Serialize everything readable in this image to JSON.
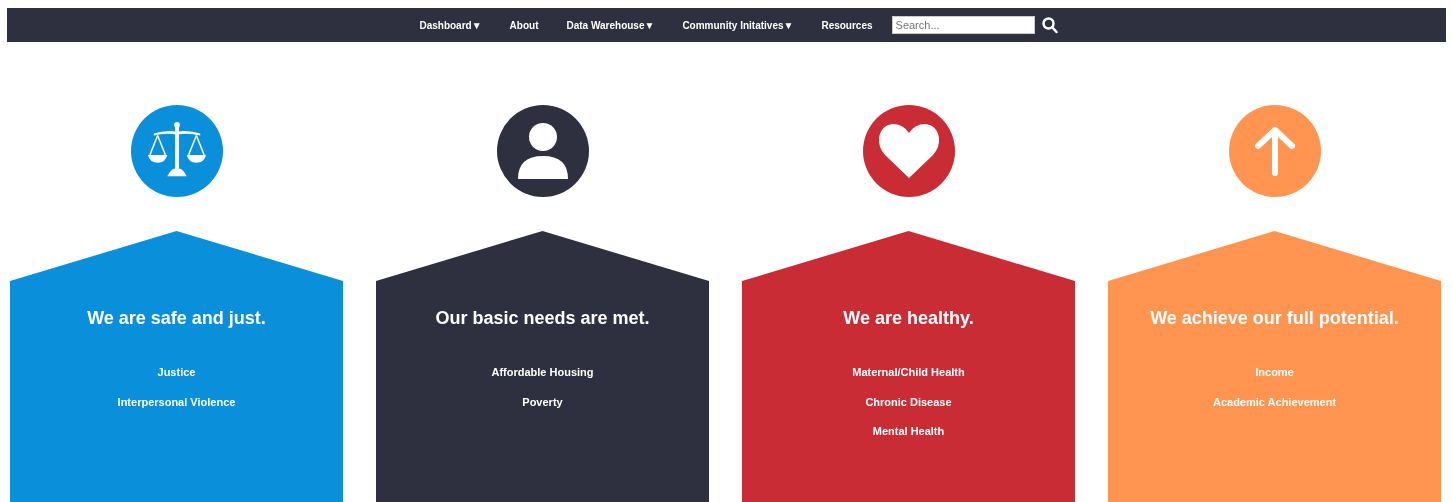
{
  "nav": {
    "items": [
      {
        "label": "Dashboard▼"
      },
      {
        "label": "About"
      },
      {
        "label": "Data Warehouse▼"
      },
      {
        "label": "Community Initatives▼"
      },
      {
        "label": "Resources"
      }
    ],
    "search": {
      "placeholder": "Search..."
    }
  },
  "cards": [
    {
      "kind": "scales",
      "color": "#0a8fdb",
      "title": "We are safe and just.",
      "links": [
        "Justice",
        "Interpersonal Violence"
      ]
    },
    {
      "kind": "person",
      "color": "#2e3040",
      "title": "Our basic needs are met.",
      "links": [
        "Affordable Housing",
        "Poverty"
      ]
    },
    {
      "kind": "heart",
      "color": "#c92c35",
      "title": "We are healthy.",
      "links": [
        "Maternal/Child Health",
        "Chronic Disease",
        "Mental Health"
      ]
    },
    {
      "kind": "arrow",
      "color": "#ff9551",
      "title": "We achieve our full potential.",
      "links": [
        "Income",
        "Academic Achievement"
      ]
    }
  ]
}
